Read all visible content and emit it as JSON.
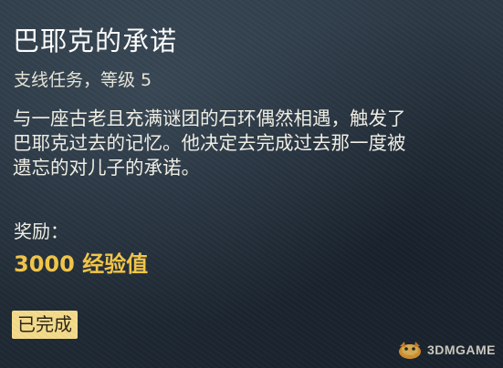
{
  "quest": {
    "title": "巴耶克的承诺",
    "subtitle": "支线任务，等级 5",
    "description_lines": [
      "与一座古老且充满谜团的石环偶然相遇，触发了",
      "巴耶克过去的记忆。他决定去完成过去那一度被",
      "遗忘的对儿子的承诺。"
    ],
    "reward_label": "奖励：",
    "reward_value": "3000 经验值",
    "status": "已完成"
  },
  "watermark": {
    "text": "3DMGAME",
    "logo_icon": "3dm-logo-icon"
  },
  "colors": {
    "background": "#26323d",
    "title": "#ffffff",
    "reward": "#f3c648",
    "badge": "#f4db8c"
  }
}
